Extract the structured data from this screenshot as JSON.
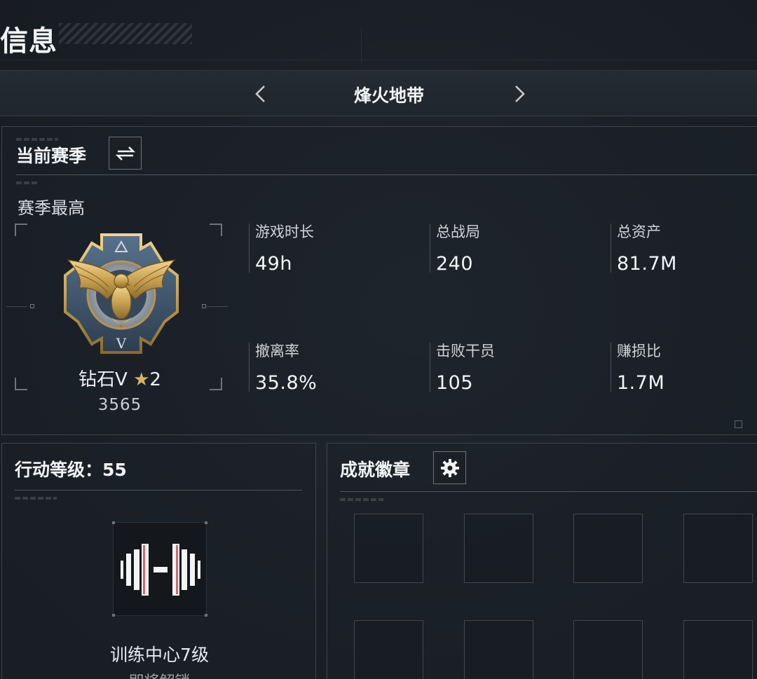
{
  "header": {
    "title": "信息"
  },
  "mode_selector": {
    "label": "烽火地带"
  },
  "season": {
    "title": "当前赛季",
    "best_label": "赛季最高",
    "rank": {
      "name": "钻石V",
      "star_glyph": "★",
      "stars": "2",
      "score": "3565"
    },
    "stats": [
      {
        "label": "游戏时长",
        "value": "49h"
      },
      {
        "label": "总战局",
        "value": "240"
      },
      {
        "label": "总资产",
        "value": "81.7M"
      },
      {
        "label": "撤离率",
        "value": "35.8%"
      },
      {
        "label": "击败干员",
        "value": "105"
      },
      {
        "label": "赚损比",
        "value": "1.7M"
      }
    ]
  },
  "level": {
    "title": "行动等级：55",
    "item_label": "训练中心7级",
    "item_status": "即将解锁"
  },
  "badges": {
    "title": "成就徽章"
  },
  "icons": {
    "prev": "chevron-left-icon",
    "next": "chevron-right-icon",
    "switch": "swap-arrows-icon",
    "settings": "gear-icon",
    "training": "dumbbell-icon",
    "rank_emblem": "eagle-emblem-icon"
  },
  "colors": {
    "background": "#1a1f26",
    "accent_gold": "#d6b45e",
    "border": "#3d454e"
  }
}
